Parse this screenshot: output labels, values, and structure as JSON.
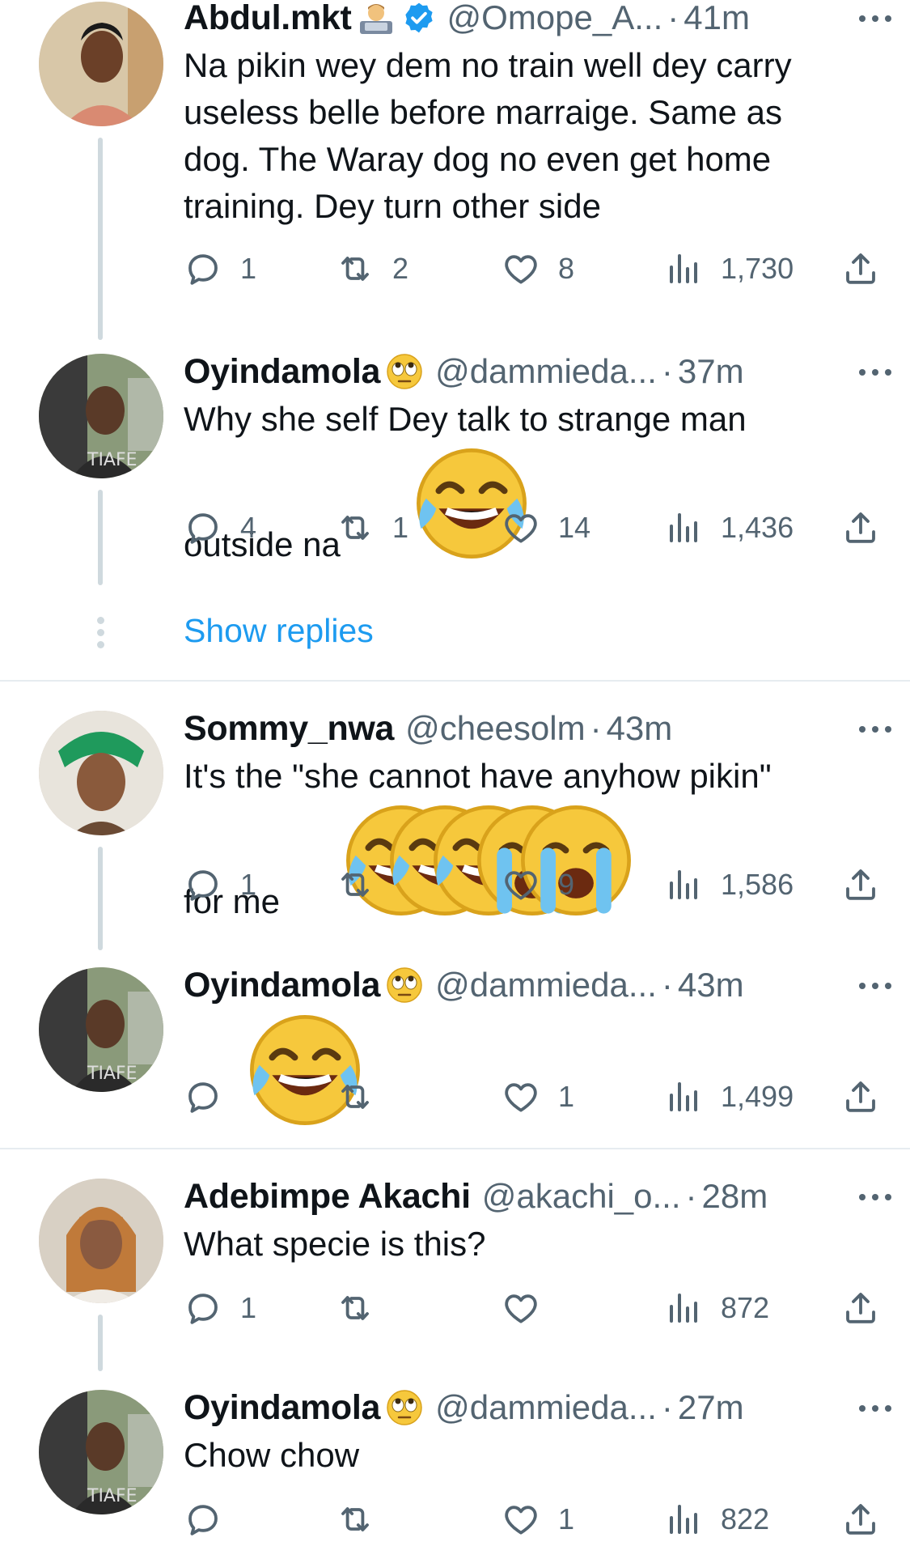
{
  "tweets": [
    {
      "name": "Abdul.mkt",
      "name_emoji": "office-worker-emoji",
      "verified": true,
      "handle": "@Omope_A...",
      "time": "41m",
      "text_lines": [
        "Na pikin wey dem no train well dey carry",
        "useless belle before marraige. Same as",
        "dog. The Waray dog no even get home",
        "training. Dey turn other side"
      ],
      "replies": "1",
      "retweets": "2",
      "likes": "8",
      "views": "1,730"
    },
    {
      "name": "Oyindamola",
      "name_emoji": "rolling-eyes-emoji",
      "handle": "@dammieda...",
      "time": "37m",
      "text_lines": [
        "Why she self Dey talk to strange man",
        "outside na"
      ],
      "replies": "4",
      "retweets": "1",
      "likes": "14",
      "views": "1,436"
    },
    {
      "name": "Sommy_nwa",
      "handle": "@cheesolm",
      "time": "43m",
      "text_lines": [
        "It's the \"she cannot have anyhow pikin\"",
        "for me"
      ],
      "replies": "1",
      "retweets": "",
      "likes": "9",
      "views": "1,586"
    },
    {
      "name": "Oyindamola",
      "name_emoji": "rolling-eyes-emoji",
      "handle": "@dammieda...",
      "time": "43m",
      "text_lines": [],
      "replies": "",
      "retweets": "",
      "likes": "1",
      "views": "1,499"
    },
    {
      "name": "Adebimpe Akachi",
      "handle": "@akachi_o...",
      "time": "28m",
      "text_lines": [
        "What specie is this?"
      ],
      "replies": "1",
      "retweets": "",
      "likes": "",
      "views": "872"
    },
    {
      "name": "Oyindamola",
      "name_emoji": "rolling-eyes-emoji",
      "handle": "@dammieda...",
      "time": "27m",
      "text_lines": [
        "Chow chow"
      ],
      "replies": "",
      "retweets": "",
      "likes": "1",
      "views": "822"
    }
  ],
  "show_replies_label": "Show replies",
  "colors": {
    "accent": "#1d9bf0",
    "muted": "#536471",
    "text": "#0f1419",
    "line": "#cfd9de"
  }
}
